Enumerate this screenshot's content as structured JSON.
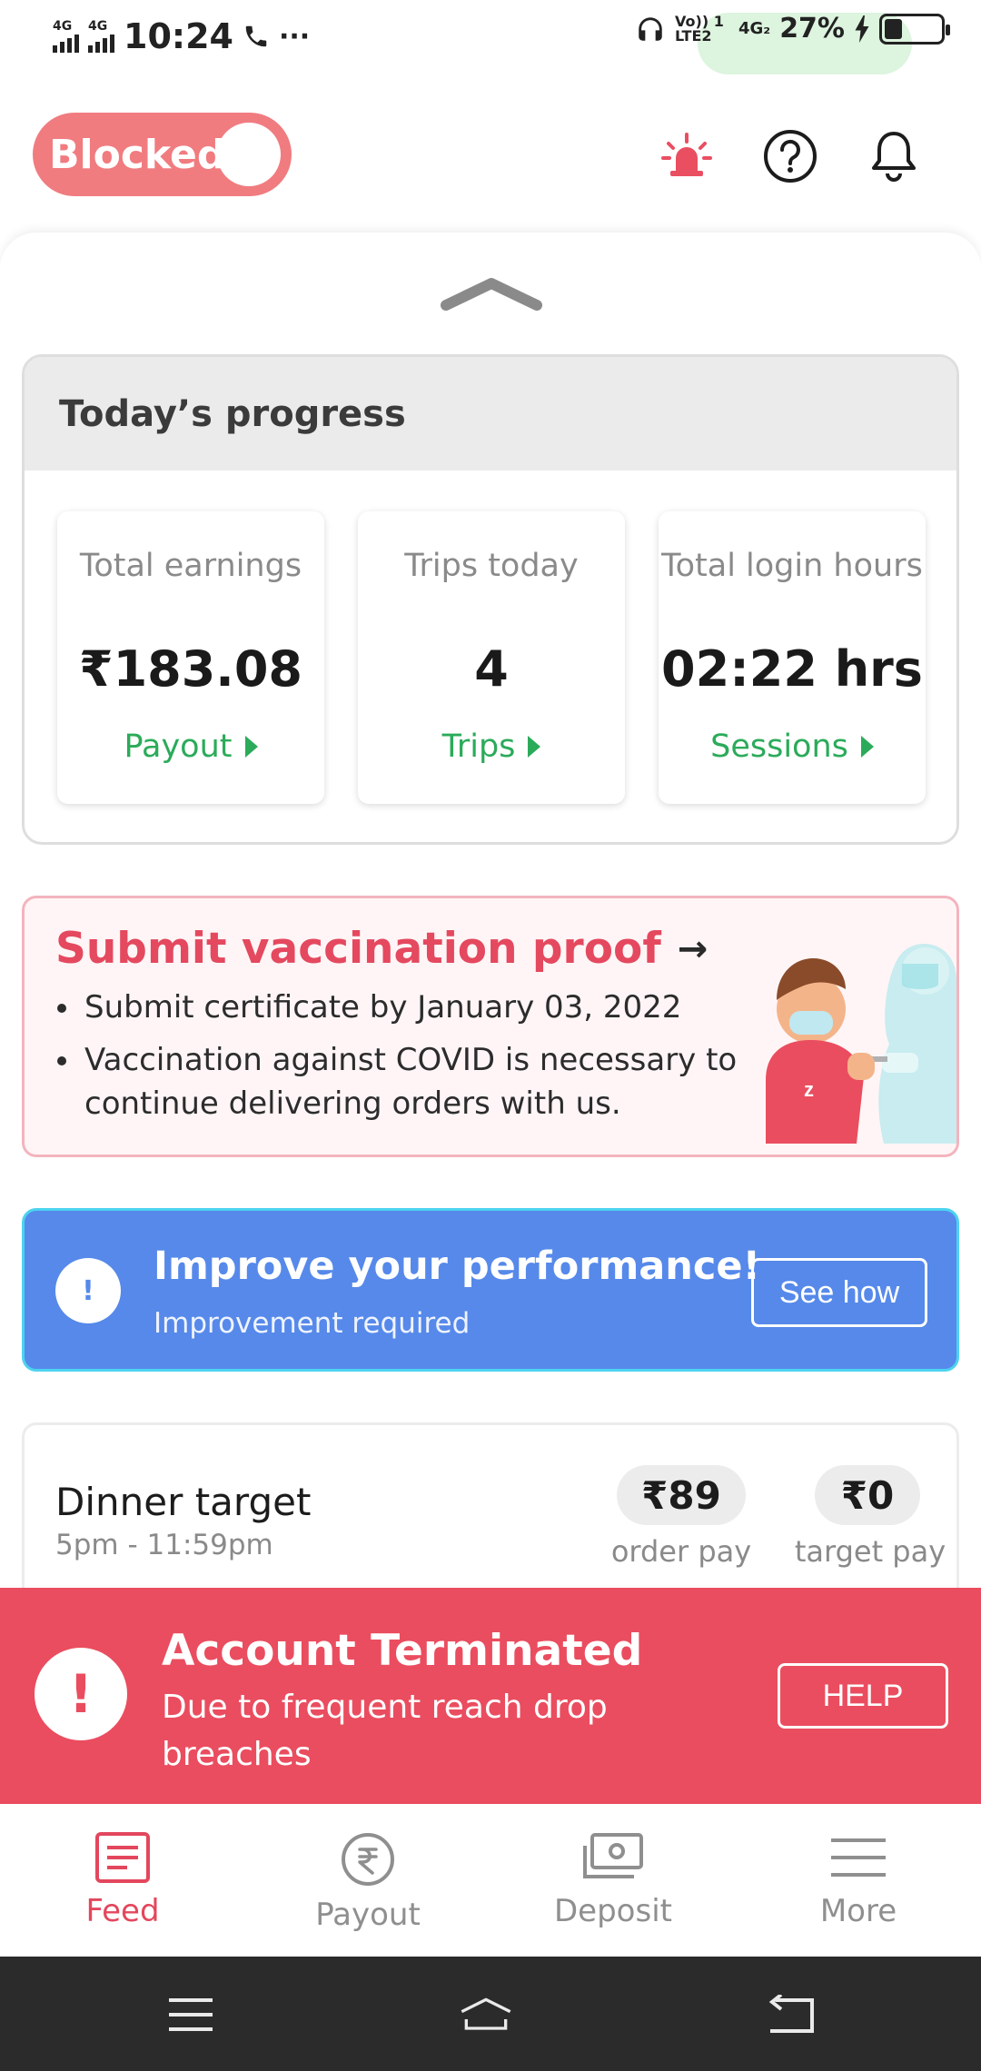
{
  "status_bar": {
    "network_left": "4G",
    "network_right": "4G",
    "time": "10:24",
    "more_indicator": "···",
    "volte": "Vo)) 1 LTE2",
    "network_sim2": "4G₂",
    "battery": "27%"
  },
  "header": {
    "toggle_label": "Blocked",
    "toggle_state": "off",
    "icons": [
      "siren-icon",
      "help-icon",
      "bell-icon"
    ],
    "accent": "#f07c80"
  },
  "progress": {
    "title": "Today’s progress",
    "stats": [
      {
        "label": "Total earnings",
        "value": "₹183.08",
        "link": "Payout"
      },
      {
        "label": "Trips today",
        "value": "4",
        "link": "Trips"
      },
      {
        "label": "Total login hours",
        "value": "02:22 hrs",
        "link": "Sessions"
      }
    ]
  },
  "vaccination": {
    "title": "Submit vaccination proof",
    "arrow": "→",
    "points": [
      "Submit certificate by January 03, 2022",
      "Vaccination against COVID is necessary to continue delivering orders with us."
    ]
  },
  "performance": {
    "icon": "!",
    "title": "Improve your performance!",
    "subtitle": "Improvement required",
    "button": "See how",
    "color": "#5689ea"
  },
  "target": {
    "title": "Dinner target",
    "time": "5pm - 11:59pm",
    "order_pay": "₹89",
    "order_pay_label": "order pay",
    "target_pay": "₹0",
    "target_pay_label": "target pay"
  },
  "termination": {
    "icon": "!",
    "title": "Account Terminated",
    "message": "Due to frequent reach drop breaches",
    "button": "HELP",
    "color": "#ea4d5f"
  },
  "bottom_nav": {
    "items": [
      {
        "label": "Feed",
        "icon": "feed-icon",
        "active": true
      },
      {
        "label": "Payout",
        "icon": "rupee-icon",
        "active": false
      },
      {
        "label": "Deposit",
        "icon": "cash-icon",
        "active": false
      },
      {
        "label": "More",
        "icon": "menu-icon",
        "active": false
      }
    ]
  },
  "system_nav": [
    "menu-icon",
    "home-icon",
    "back-icon"
  ]
}
